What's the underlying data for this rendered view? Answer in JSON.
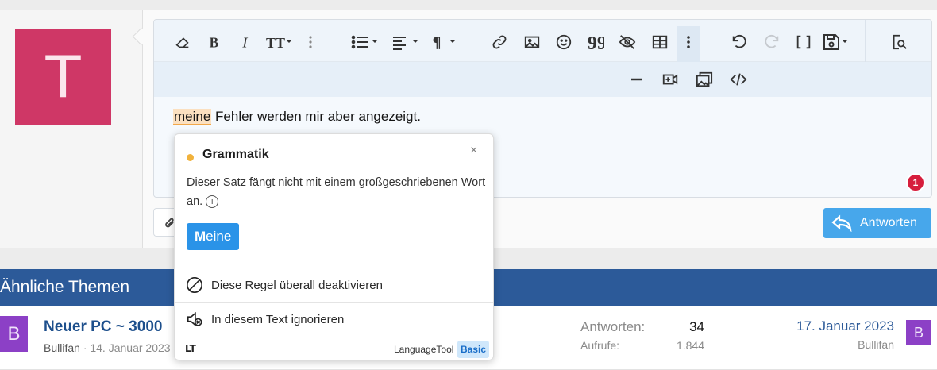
{
  "user": {
    "avatar_letter": "T",
    "avatar_color": "#cf3766"
  },
  "toolbar": {
    "icons": [
      "eraser-icon",
      "bold-icon",
      "italic-icon",
      "text-size-icon",
      "more-vertical-icon",
      "list-icon",
      "align-icon",
      "paragraph-icon",
      "link-icon",
      "image-icon",
      "smiley-icon",
      "quote-icon",
      "spoiler-icon",
      "table-icon",
      "more-vertical-icon",
      "undo-icon",
      "redo-icon",
      "brackets-icon",
      "save-draft-icon",
      "preview-icon"
    ],
    "row2_icons": [
      "horizontal-rule-icon",
      "insert-media-icon",
      "gallery-icon",
      "code-icon"
    ]
  },
  "editor": {
    "highlighted_word": "meine",
    "text_rest": " Fehler werden mir aber angezeigt.",
    "issue_count": "1"
  },
  "reply_button": {
    "label": "Antworten",
    "color": "#47a7eb"
  },
  "languagetool": {
    "category": "Grammatik",
    "description": "Dieser Satz fängt nicht mit einem großgeschriebenen Wort an.",
    "info_symbol": "i",
    "suggestion_bold": "M",
    "suggestion_rest": "eine",
    "close_symbol": "×",
    "action_disable": "Diese Regel überall deaktivieren",
    "action_ignore": "In diesem Text ignorieren",
    "logo": "LT",
    "brand": "LanguageTool",
    "plan": "Basic"
  },
  "similar": {
    "heading": "Ähnliche Themen",
    "accent": "#2c5a99",
    "thread": {
      "avatar_letter": "B",
      "avatar_color": "#8c40c6",
      "title": "Neuer PC ~ 3000",
      "author": "Bullifan",
      "date": "· 14. Januar 2023",
      "replies_label": "Antworten:",
      "replies_value": "34",
      "views_label": "Aufrufe:",
      "views_value": "1.844",
      "last_date": "17. Januar 2023",
      "last_user": "Bullifan",
      "last_avatar_letter": "B"
    }
  }
}
